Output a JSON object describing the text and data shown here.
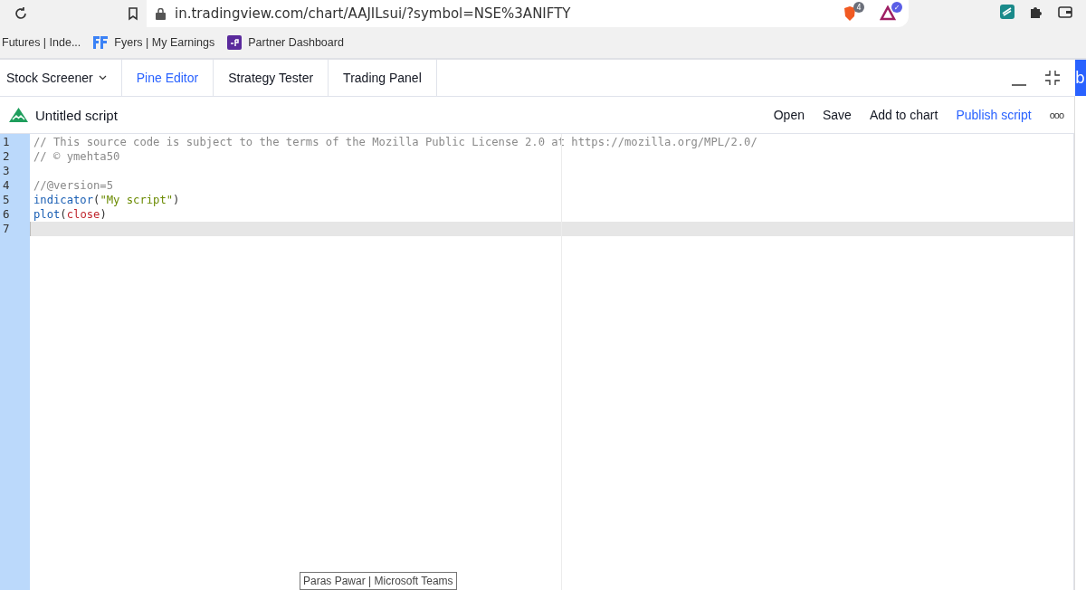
{
  "browser": {
    "url": "in.tradingview.com/chart/AAJILsui/?symbol=NSE%3ANIFTY",
    "shield_count": "4",
    "rewards_badge": "✓",
    "bookmarks": [
      {
        "label": "Futures | Inde...",
        "kind": "plain"
      },
      {
        "label": "Fyers | My Earnings",
        "kind": "fyers"
      },
      {
        "label": "Partner Dashboard",
        "kind": "upstox"
      }
    ]
  },
  "panel": {
    "tabs": [
      {
        "label": "Stock Screener",
        "selected": false,
        "dropdown": true
      },
      {
        "label": "Pine Editor",
        "selected": true,
        "dropdown": false
      },
      {
        "label": "Strategy Tester",
        "selected": false,
        "dropdown": false
      },
      {
        "label": "Trading Panel",
        "selected": false,
        "dropdown": false
      }
    ],
    "side_tab": "b"
  },
  "script": {
    "title": "Untitled script",
    "actions": [
      {
        "label": "Open",
        "primary": false
      },
      {
        "label": "Save",
        "primary": false
      },
      {
        "label": "Add to chart",
        "primary": false
      },
      {
        "label": "Publish script",
        "primary": true
      }
    ],
    "more": "ooo"
  },
  "code_lines": [
    {
      "number": "1",
      "current": false,
      "tokens": [
        {
          "kind": "comment",
          "text": "// This source code is subject to the terms of the Mozilla Public License 2.0 at https://mozilla.org/MPL/2.0/"
        }
      ]
    },
    {
      "number": "2",
      "current": false,
      "tokens": [
        {
          "kind": "comment",
          "text": "// © ymehta50"
        }
      ]
    },
    {
      "number": "3",
      "current": false
    },
    {
      "number": "4",
      "current": false,
      "tokens": [
        {
          "kind": "comment",
          "text": "//@version=5"
        }
      ]
    },
    {
      "number": "5",
      "current": false,
      "tokens": [
        {
          "kind": "function",
          "text": "indicator"
        },
        {
          "kind": "plain",
          "text": "("
        },
        {
          "kind": "string",
          "text": "\"My script\""
        },
        {
          "kind": "plain",
          "text": ")"
        }
      ]
    },
    {
      "number": "6",
      "current": false,
      "tokens": [
        {
          "kind": "function",
          "text": "plot"
        },
        {
          "kind": "plain",
          "text": "("
        },
        {
          "kind": "variable",
          "text": "close"
        },
        {
          "kind": "plain",
          "text": ")"
        }
      ]
    },
    {
      "number": "7",
      "current": true
    }
  ],
  "tooltip": "Paras Pawar | Microsoft Teams"
}
